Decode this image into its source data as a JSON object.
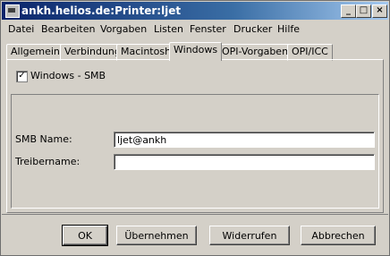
{
  "window": {
    "title": "ankh.helios.de:Printer:ljet",
    "minimize": "_",
    "maximize": "□",
    "close": "×"
  },
  "menu": [
    "Datei",
    "Bearbeiten",
    "Vorgaben",
    "Listen",
    "Fenster",
    "Drucker",
    "Hilfe"
  ],
  "tabs": [
    "Allgemein",
    "Verbindung",
    "Macintosh",
    "Windows",
    "OPI-Vorgaben",
    "OPI/ICC"
  ],
  "active_tab": "Windows",
  "windows_smb": {
    "checked": true,
    "check_mark": "✓",
    "label": "Windows - SMB"
  },
  "fields": {
    "smb_name": {
      "label": "SMB Name:",
      "value": "ljet@ankh"
    },
    "treibername": {
      "label": "Treibername:",
      "value": ""
    }
  },
  "buttons": {
    "ok": "OK",
    "apply": "Übernehmen",
    "revert": "Widerrufen",
    "cancel": "Abbrechen"
  }
}
